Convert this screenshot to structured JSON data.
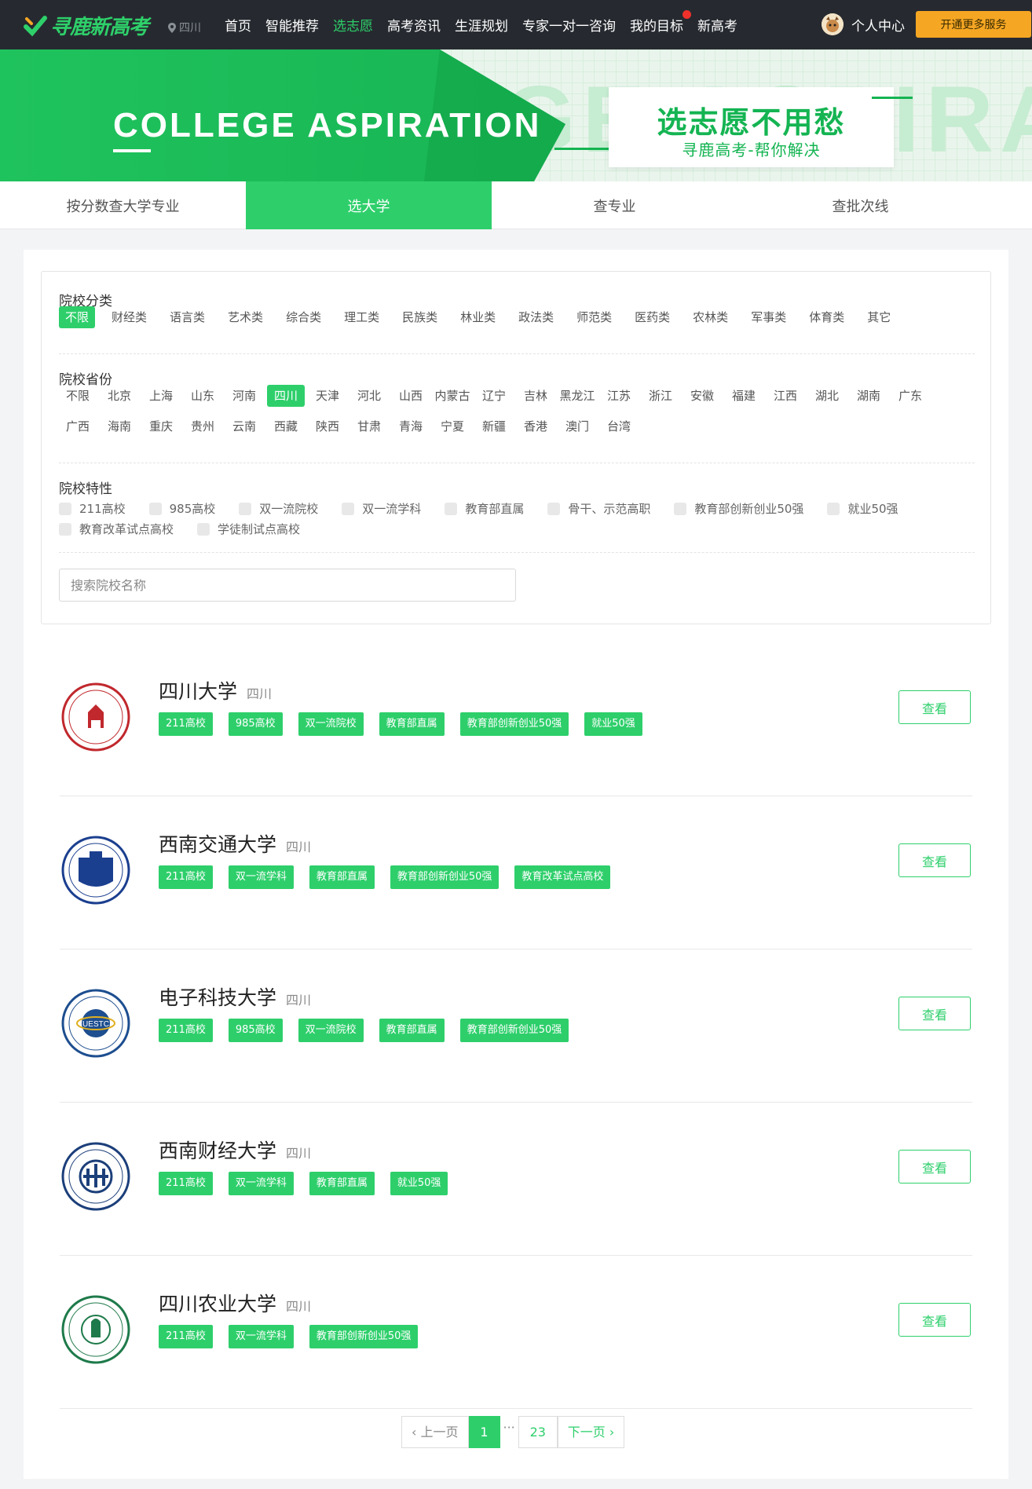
{
  "header": {
    "logo_text": "寻鹿新高考",
    "location": "四川",
    "nav": [
      "首页",
      "智能推荐",
      "选志愿",
      "高考资讯",
      "生涯规划",
      "专家一对一咨询",
      "我的目标",
      "新高考"
    ],
    "active_nav": "选志愿",
    "user_center": "个人中心",
    "vip_button": "开通更多服务"
  },
  "banner": {
    "title": "COLLEGE ASPIRATION",
    "bg_text": "GE ASPIRAT",
    "card_title": "选志愿不用愁",
    "card_sub": "寻鹿高考-帮你解决"
  },
  "tabs": [
    "按分数查大学专业",
    "选大学",
    "查专业",
    "查批次线"
  ],
  "filters": {
    "category": {
      "title": "院校分类",
      "options": [
        "不限",
        "财经类",
        "语言类",
        "艺术类",
        "综合类",
        "理工类",
        "民族类",
        "林业类",
        "政法类",
        "师范类",
        "医药类",
        "农林类",
        "军事类",
        "体育类",
        "其它"
      ],
      "selected": "不限"
    },
    "province": {
      "title": "院校省份",
      "row1": [
        "不限",
        "北京",
        "上海",
        "山东",
        "河南",
        "四川",
        "天津",
        "河北",
        "山西",
        "内蒙古",
        "辽宁",
        "吉林",
        "黑龙江",
        "江苏",
        "浙江",
        "安徽",
        "福建",
        "江西",
        "湖北",
        "湖南",
        "广东"
      ],
      "row2": [
        "广西",
        "海南",
        "重庆",
        "贵州",
        "云南",
        "西藏",
        "陕西",
        "甘肃",
        "青海",
        "宁夏",
        "新疆",
        "香港",
        "澳门",
        "台湾"
      ],
      "selected": "四川"
    },
    "features": {
      "title": "院校特性",
      "row1": [
        "211高校",
        "985高校",
        "双一流院校",
        "双一流学科",
        "教育部直属",
        "骨干、示范高职",
        "教育部创新创业50强",
        "就业50强"
      ],
      "row2": [
        "教育改革试点高校",
        "学徒制试点高校"
      ]
    },
    "search_placeholder": "搜索院校名称"
  },
  "schools": [
    {
      "name": "四川大学",
      "province": "四川",
      "tags": [
        "211高校",
        "985高校",
        "双一流院校",
        "教育部直属",
        "教育部创新创业50强",
        "就业50强"
      ],
      "logo_color": "#c0282d"
    },
    {
      "name": "西南交通大学",
      "province": "四川",
      "tags": [
        "211高校",
        "双一流学科",
        "教育部直属",
        "教育部创新创业50强",
        "教育改革试点高校"
      ],
      "logo_color": "#1b3f8f"
    },
    {
      "name": "电子科技大学",
      "province": "四川",
      "tags": [
        "211高校",
        "985高校",
        "双一流院校",
        "教育部直属",
        "教育部创新创业50强"
      ],
      "logo_color": "#1d4e8f"
    },
    {
      "name": "西南财经大学",
      "province": "四川",
      "tags": [
        "211高校",
        "双一流学科",
        "教育部直属",
        "就业50强"
      ],
      "logo_color": "#1c3f7a"
    },
    {
      "name": "四川农业大学",
      "province": "四川",
      "tags": [
        "211高校",
        "双一流学科",
        "教育部创新创业50强"
      ],
      "logo_color": "#1e7a4a"
    }
  ],
  "view_label": "查看",
  "pagination": {
    "prev": "上一页",
    "current": "1",
    "ellipsis": "···",
    "last": "23",
    "next": "下一页"
  },
  "colors": {
    "accent": "#2ecf6b",
    "topbar": "#262a30",
    "vip": "#f5a623"
  }
}
